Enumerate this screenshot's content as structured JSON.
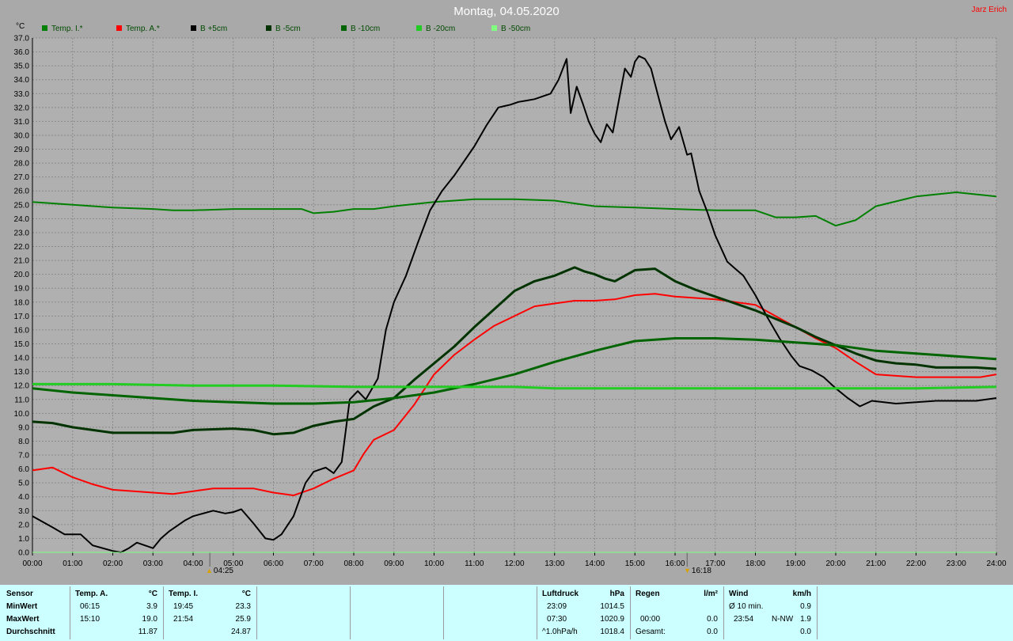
{
  "header": {
    "title": "Montag, 04.05.2020",
    "author": "Jarz Erich"
  },
  "legend": [
    {
      "name": "Temp. I.*",
      "color": "#008000"
    },
    {
      "name": "Temp. A.*",
      "color": "#ff0000"
    },
    {
      "name": "B +5cm",
      "color": "#000000"
    },
    {
      "name": "B -5cm",
      "color": "#003300"
    },
    {
      "name": "B -10cm",
      "color": "#006400"
    },
    {
      "name": "B -20cm",
      "color": "#22cc22"
    },
    {
      "name": "B -50cm",
      "color": "#80ff80"
    }
  ],
  "sun": {
    "sunrise": "04:25",
    "sunset": "16:18"
  },
  "chart_data": {
    "type": "line",
    "ylabel": "°C",
    "ylim": [
      0,
      37
    ],
    "yticks": [
      "0.0",
      "1.0",
      "2.0",
      "3.0",
      "4.0",
      "5.0",
      "6.0",
      "7.0",
      "8.0",
      "9.0",
      "10.0",
      "11.0",
      "12.0",
      "13.0",
      "14.0",
      "15.0",
      "16.0",
      "17.0",
      "18.0",
      "19.0",
      "20.0",
      "21.0",
      "22.0",
      "23.0",
      "24.0",
      "25.0",
      "26.0",
      "27.0",
      "28.0",
      "29.0",
      "30.0",
      "31.0",
      "32.0",
      "33.0",
      "34.0",
      "35.0",
      "36.0",
      "37.0"
    ],
    "xticks": [
      "00:00",
      "01:00",
      "02:00",
      "03:00",
      "04:00",
      "05:00",
      "06:00",
      "07:00",
      "08:00",
      "09:00",
      "10:00",
      "11:00",
      "12:00",
      "13:00",
      "14:00",
      "15:00",
      "16:00",
      "17:00",
      "18:00",
      "19:00",
      "20:00",
      "21:00",
      "22:00",
      "23:00",
      "24:00"
    ],
    "xlim": [
      0,
      24
    ],
    "grid": true,
    "legend_position": "top-left",
    "series": [
      {
        "name": "Temp. I.*",
        "color": "#008000",
        "width": 2,
        "x": [
          0,
          1,
          2,
          3,
          3.5,
          4,
          5,
          6,
          6.7,
          7,
          7.5,
          8,
          8.5,
          9,
          10,
          11,
          12,
          13,
          14,
          15,
          16,
          17,
          18,
          18.5,
          19,
          19.5,
          20,
          20.5,
          21,
          22,
          23,
          24
        ],
        "y": [
          25.2,
          25.0,
          24.8,
          24.7,
          24.6,
          24.6,
          24.7,
          24.7,
          24.7,
          24.4,
          24.5,
          24.7,
          24.7,
          24.9,
          25.2,
          25.4,
          25.4,
          25.3,
          24.9,
          24.8,
          24.7,
          24.6,
          24.6,
          24.1,
          24.1,
          24.2,
          23.5,
          23.9,
          24.9,
          25.6,
          25.9,
          25.6
        ]
      },
      {
        "name": "Temp. A.*",
        "color": "#ff0000",
        "width": 2,
        "x": [
          0,
          0.5,
          1,
          1.5,
          2,
          3,
          3.5,
          4,
          4.5,
          5,
          5.5,
          6,
          6.5,
          7,
          7.5,
          8,
          8.25,
          8.5,
          9,
          9.5,
          10,
          10.5,
          11,
          11.5,
          12,
          12.5,
          13,
          13.5,
          14,
          14.5,
          15,
          15.5,
          16,
          16.5,
          17,
          17.5,
          18,
          18.5,
          19,
          19.5,
          20,
          20.5,
          21,
          21.5,
          22,
          23,
          23.6,
          24
        ],
        "y": [
          5.9,
          6.1,
          5.4,
          4.9,
          4.5,
          4.3,
          4.2,
          4.4,
          4.6,
          4.6,
          4.6,
          4.3,
          4.1,
          4.6,
          5.3,
          5.9,
          7.1,
          8.1,
          8.8,
          10.6,
          12.8,
          14.2,
          15.3,
          16.3,
          17.0,
          17.7,
          17.9,
          18.1,
          18.1,
          18.2,
          18.5,
          18.6,
          18.4,
          18.3,
          18.2,
          18.0,
          17.8,
          17.0,
          16.2,
          15.4,
          14.7,
          13.7,
          12.8,
          12.7,
          12.6,
          12.6,
          12.6,
          12.8
        ]
      },
      {
        "name": "B +5cm",
        "color": "#000000",
        "width": 2,
        "x": [
          0,
          0.5,
          0.8,
          1.2,
          1.5,
          2,
          2.2,
          2.4,
          2.6,
          2.8,
          3,
          3.2,
          3.4,
          3.6,
          3.8,
          4,
          4.5,
          4.8,
          5,
          5.2,
          5.5,
          5.8,
          6,
          6.2,
          6.5,
          6.8,
          7,
          7.3,
          7.5,
          7.7,
          7.9,
          8.1,
          8.3,
          8.6,
          8.8,
          9,
          9.3,
          9.6,
          9.9,
          10.2,
          10.5,
          11,
          11.3,
          11.6,
          11.9,
          12.1,
          12.3,
          12.5,
          12.7,
          12.9,
          13.1,
          13.3,
          13.4,
          13.55,
          13.7,
          13.85,
          14,
          14.15,
          14.3,
          14.45,
          14.6,
          14.75,
          14.9,
          15,
          15.1,
          15.25,
          15.4,
          15.6,
          15.75,
          15.9,
          16.1,
          16.3,
          16.4,
          16.6,
          16.8,
          17,
          17.3,
          17.5,
          17.7,
          18,
          18.3,
          18.6,
          18.9,
          19.1,
          19.4,
          19.7,
          20,
          20.3,
          20.6,
          20.9,
          21.2,
          21.5,
          22,
          22.5,
          23,
          23.5,
          24
        ],
        "y": [
          2.6,
          1.8,
          1.3,
          1.3,
          0.5,
          0.1,
          0.0,
          0.3,
          0.7,
          0.5,
          0.3,
          1.0,
          1.5,
          1.9,
          2.3,
          2.6,
          3.0,
          2.8,
          2.9,
          3.1,
          2.1,
          1.0,
          0.9,
          1.3,
          2.6,
          5.0,
          5.8,
          6.1,
          5.7,
          6.5,
          11.0,
          11.6,
          11.0,
          12.5,
          16.0,
          18.0,
          19.9,
          22.3,
          24.6,
          26.0,
          27.1,
          29.2,
          30.7,
          32.0,
          32.2,
          32.4,
          32.5,
          32.6,
          32.8,
          33.0,
          34.0,
          35.5,
          31.6,
          33.5,
          32.3,
          31.0,
          30.1,
          29.5,
          30.8,
          30.2,
          32.5,
          34.8,
          34.2,
          35.3,
          35.7,
          35.5,
          34.8,
          32.6,
          31.0,
          29.7,
          30.6,
          28.6,
          28.7,
          26.0,
          24.5,
          22.8,
          20.9,
          20.4,
          19.9,
          18.5,
          16.9,
          15.4,
          14.1,
          13.4,
          13.1,
          12.6,
          11.8,
          11.1,
          10.5,
          10.9,
          10.8,
          10.7,
          10.8,
          10.9,
          10.9,
          10.9,
          11.1
        ]
      },
      {
        "name": "B -5cm",
        "color": "#003300",
        "width": 3,
        "x": [
          0,
          0.5,
          1,
          1.5,
          2,
          3,
          3.5,
          4,
          5,
          5.5,
          6,
          6.5,
          7,
          7.5,
          8,
          8.5,
          9,
          9.5,
          10,
          10.5,
          11,
          11.5,
          12,
          12.5,
          13,
          13.25,
          13.5,
          13.75,
          14,
          14.25,
          14.5,
          15,
          15.5,
          16,
          16.5,
          17,
          17.5,
          18,
          18.5,
          19,
          19.5,
          20,
          20.5,
          21,
          21.5,
          22,
          22.5,
          23,
          23.5,
          24
        ],
        "y": [
          9.4,
          9.3,
          9.0,
          8.8,
          8.6,
          8.6,
          8.6,
          8.8,
          8.9,
          8.8,
          8.5,
          8.6,
          9.1,
          9.4,
          9.6,
          10.5,
          11.1,
          12.4,
          13.6,
          14.8,
          16.2,
          17.5,
          18.8,
          19.5,
          19.9,
          20.2,
          20.5,
          20.2,
          20.0,
          19.7,
          19.5,
          20.3,
          20.4,
          19.5,
          18.9,
          18.4,
          17.9,
          17.4,
          16.8,
          16.2,
          15.5,
          14.9,
          14.3,
          13.8,
          13.6,
          13.5,
          13.3,
          13.3,
          13.3,
          13.2
        ]
      },
      {
        "name": "B -10cm",
        "color": "#006400",
        "width": 3,
        "x": [
          0,
          1,
          2,
          3,
          4,
          5,
          6,
          7,
          8,
          9,
          10,
          11,
          12,
          13,
          14,
          15,
          16,
          17,
          18,
          19,
          20,
          21,
          22,
          23,
          24
        ],
        "y": [
          11.8,
          11.5,
          11.3,
          11.1,
          10.9,
          10.8,
          10.7,
          10.7,
          10.8,
          11.1,
          11.5,
          12.1,
          12.8,
          13.7,
          14.5,
          15.2,
          15.4,
          15.4,
          15.3,
          15.1,
          14.9,
          14.5,
          14.3,
          14.1,
          13.9
        ]
      },
      {
        "name": "B -20cm",
        "color": "#22cc22",
        "width": 3,
        "x": [
          0,
          2,
          4,
          6,
          8,
          10,
          12,
          13,
          14,
          16,
          18,
          20,
          22,
          24
        ],
        "y": [
          12.1,
          12.1,
          12.0,
          12.0,
          11.9,
          11.9,
          11.9,
          11.8,
          11.8,
          11.8,
          11.8,
          11.8,
          11.8,
          11.9
        ]
      },
      {
        "name": "B -50cm",
        "color": "#80ff80",
        "width": 1,
        "x": [
          0,
          24
        ],
        "y": [
          0.0,
          0.0
        ]
      }
    ]
  },
  "stats": {
    "sensor": {
      "title": "Sensor",
      "rows": [
        "MinWert",
        "MaxWert",
        "Durchschnitt"
      ]
    },
    "temp_a": {
      "title": "Temp. A.",
      "unit": "°C",
      "min_time": "06:15",
      "min": "3.9",
      "max_time": "15:10",
      "max": "19.0",
      "avg": "11.87"
    },
    "temp_i": {
      "title": "Temp. I.",
      "unit": "°C",
      "min_time": "19:45",
      "min": "23.3",
      "max_time": "21:54",
      "max": "25.9",
      "avg": "24.87"
    },
    "pressure": {
      "title": "Luftdruck",
      "unit": "hPa",
      "r1_label": "23:09",
      "r1_value": "1014.5",
      "r2_label": "07:30",
      "r2_value": "1020.9",
      "r3_label": "^1.0hPa/h",
      "r3_value": "1018.4"
    },
    "rain": {
      "title": "Regen",
      "unit": "l/m²",
      "r2_label": "00:00",
      "r2_value": "0.0",
      "r3_label": "Gesamt:",
      "r3_value": "0.0"
    },
    "wind": {
      "title": "Wind",
      "unit": "km/h",
      "r1_label": "Ø 10 min.",
      "r1_value": "0.9",
      "r2_label": "23:54",
      "r2_dir": "N-NW",
      "r2_value": "1.9",
      "r3_value": "0.0"
    }
  }
}
